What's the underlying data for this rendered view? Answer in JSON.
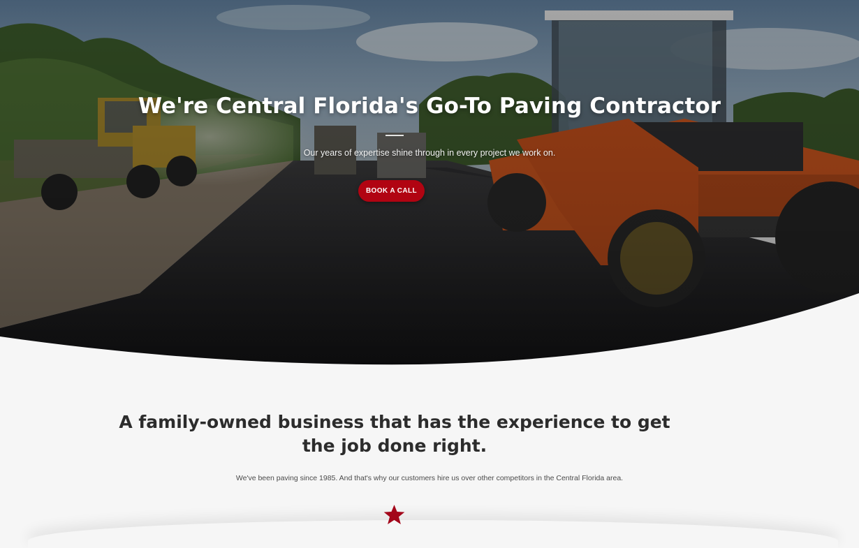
{
  "hero": {
    "title": "We're Central Florida's Go-To Paving Contractor",
    "subtitle": "Our years of expertise shine through in every project we work on.",
    "cta_label": "BOOK A CALL"
  },
  "about": {
    "heading": "A family-owned business that has the experience to get the job done right.",
    "text": "We've been paving since 1985. And that's why our customers hire us over other competitors in the Central Florida area.",
    "icon": "star-icon"
  },
  "colors": {
    "accent": "#b10412",
    "page_background": "#f6f6f6",
    "heading_text": "#2c2c2c"
  }
}
